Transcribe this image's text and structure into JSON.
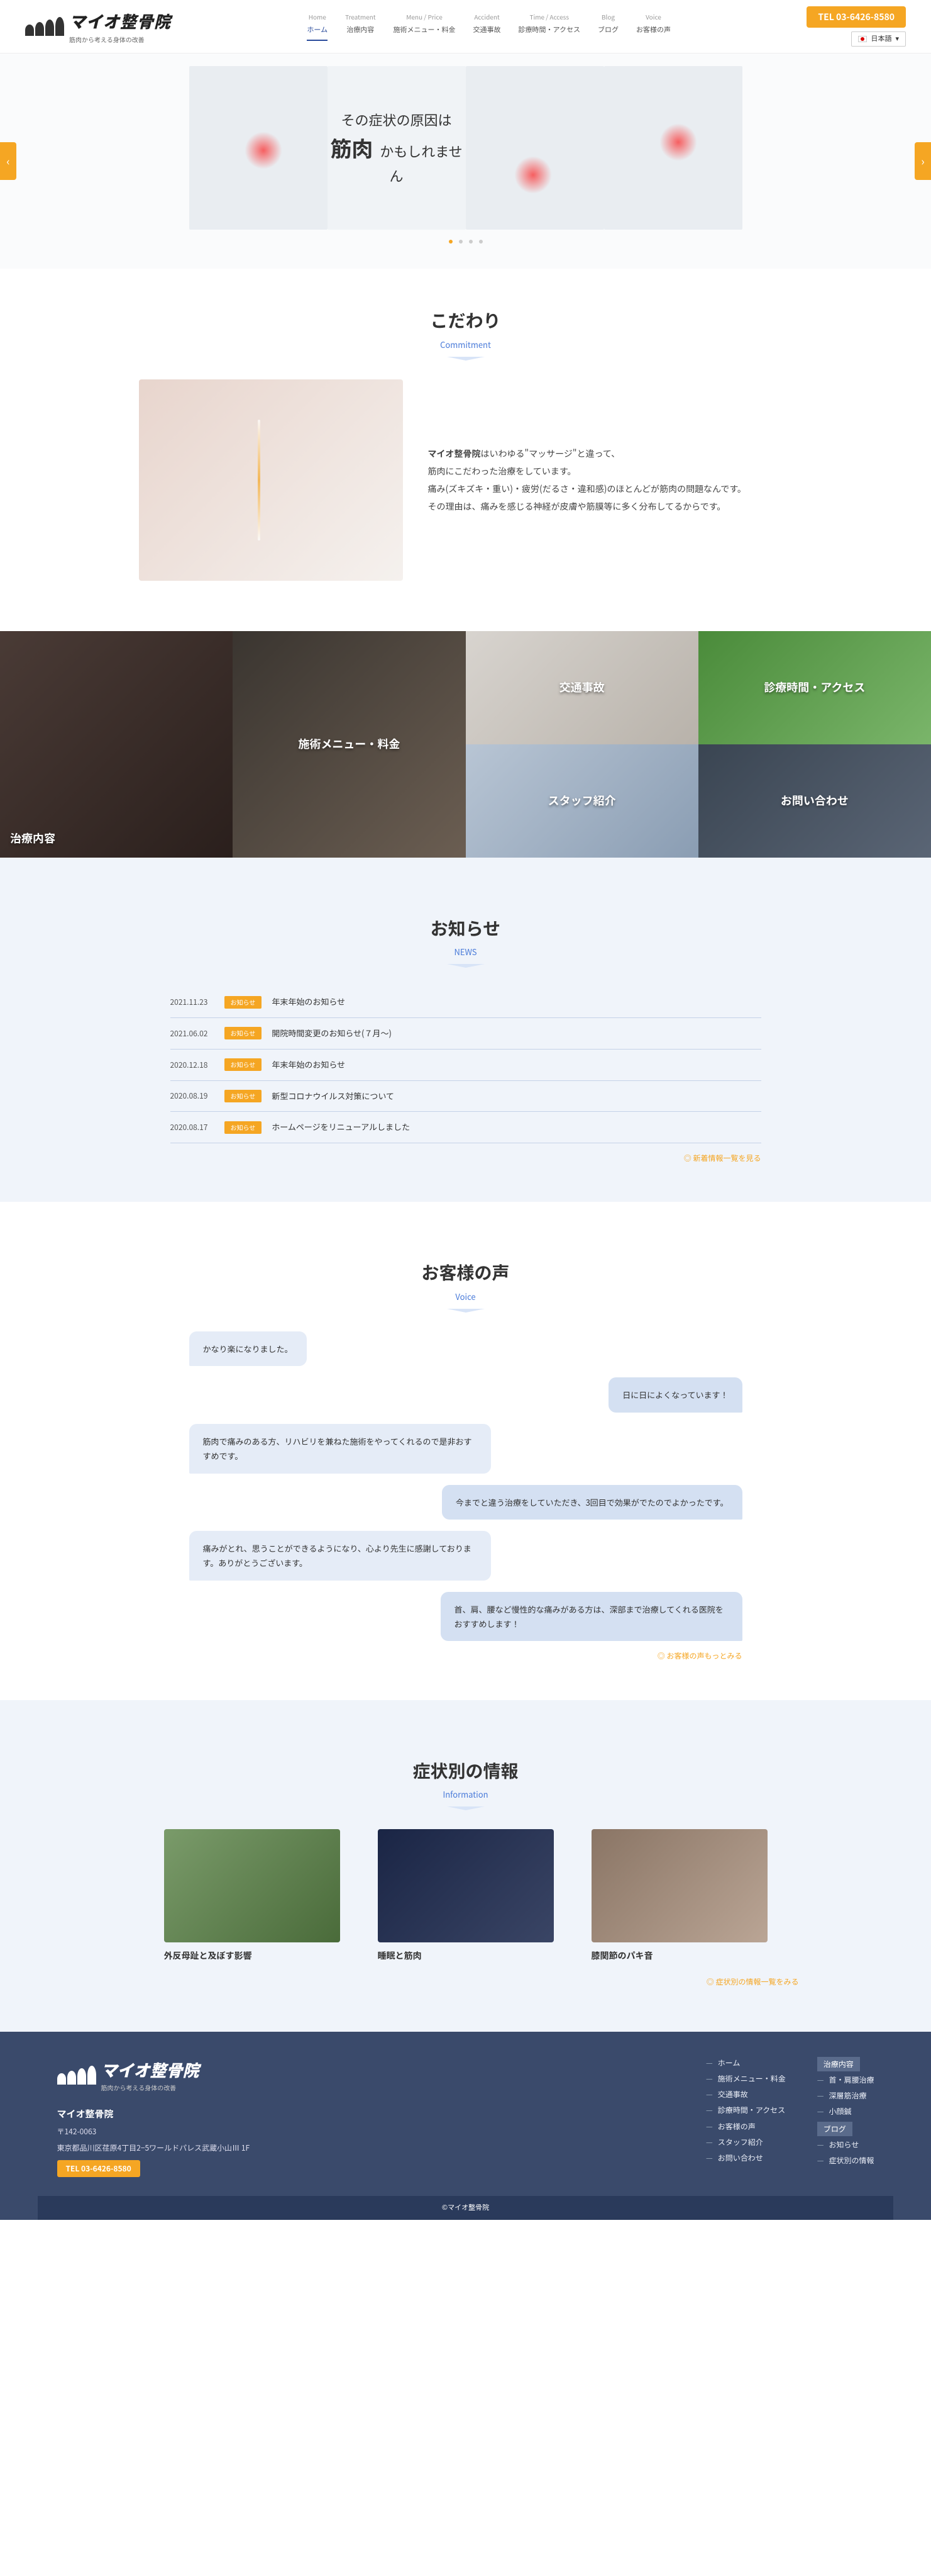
{
  "header": {
    "logo_main": "マイオ整骨院",
    "logo_sub": "筋肉から考える身体の改善",
    "nav": [
      {
        "en": "Home",
        "ja": "ホーム"
      },
      {
        "en": "Treatment",
        "ja": "治療内容"
      },
      {
        "en": "Menu / Price",
        "ja": "施術メニュー・料金"
      },
      {
        "en": "Accident",
        "ja": "交通事故"
      },
      {
        "en": "Time / Access",
        "ja": "診療時間・アクセス"
      },
      {
        "en": "Blog",
        "ja": "ブログ"
      },
      {
        "en": "Voice",
        "ja": "お客様の声"
      }
    ],
    "tel_label": "TEL  03-6426-8580",
    "lang": "日本語"
  },
  "hero": {
    "line1": "その症状の原因は",
    "big": "筋肉",
    "after": " かもしれません"
  },
  "commit": {
    "title": "こだわり",
    "title_en": "Commitment",
    "p1_bold": "マイオ整骨院",
    "p1_rest": "はいわゆる\"マッサージ\"と違って、",
    "p2": "筋肉にこだわった治療をしています。",
    "p3": "痛み(ズキズキ・重い)・疲労(だるさ・違和感)のほとんどが筋肉の問題なんです。",
    "p4": "その理由は、痛みを感じる神経が皮膚や筋膜等に多く分布してるからです。"
  },
  "grid": [
    "治療内容",
    "施術メニュー・料金",
    "交通事故",
    "診療時間・アクセス",
    "スタッフ紹介",
    "お問い合わせ"
  ],
  "news": {
    "title": "お知らせ",
    "title_en": "NEWS",
    "tag": "お知らせ",
    "items": [
      {
        "date": "2021.11.23",
        "title": "年末年始のお知らせ"
      },
      {
        "date": "2021.06.02",
        "title": "開院時間変更のお知らせ(７月〜)"
      },
      {
        "date": "2020.12.18",
        "title": "年末年始のお知らせ"
      },
      {
        "date": "2020.08.19",
        "title": "新型コロナウイルス対策について"
      },
      {
        "date": "2020.08.17",
        "title": "ホームページをリニューアルしました"
      }
    ],
    "more": "新着情報一覧を見る"
  },
  "voice": {
    "title": "お客様の声",
    "title_en": "Voice",
    "items": [
      {
        "side": "left",
        "text": "かなり楽になりました。"
      },
      {
        "side": "right",
        "text": "日に日によくなっています！"
      },
      {
        "side": "left",
        "text": "筋肉で痛みのある方、リハビリを兼ねた施術をやってくれるので是非おすすめです。"
      },
      {
        "side": "right",
        "text": "今までと違う治療をしていただき、3回目で効果がでたのでよかったです。"
      },
      {
        "side": "left",
        "text": "痛みがとれ、思うことができるようになり、心より先生に感謝しております。ありがとうございます。"
      },
      {
        "side": "right",
        "text": "首、肩、腰など慢性的な痛みがある方は、深部まで治療してくれる医院をおすすめします！"
      }
    ],
    "more": "お客様の声もっとみる"
  },
  "info": {
    "title": "症状別の情報",
    "title_en": "Information",
    "cards": [
      {
        "title": "外反母趾と及ぼす影響"
      },
      {
        "title": "睡眠と筋肉"
      },
      {
        "title": "膝関節のパキ音"
      }
    ],
    "more": "症状別の情報一覧をみる"
  },
  "footer": {
    "name": "マイオ整骨院",
    "zip": "〒142-0063",
    "addr": "東京都品川区荏原4丁目2−5ワールドパレス武蔵小山Ⅲ 1F",
    "tel": "TEL  03-6426-8580",
    "col1": [
      "ホーム",
      "施術メニュー・料金",
      "交通事故",
      "診療時間・アクセス",
      "お客様の声",
      "スタッフ紹介",
      "お問い合わせ"
    ],
    "col2_h1": "治療内容",
    "col2_a": [
      "首・肩腰治療",
      "深層筋治療",
      "小顔鍼"
    ],
    "col2_h2": "ブログ",
    "col2_b": [
      "お知らせ",
      "症状別の情報"
    ],
    "copy": "©マイオ整骨院"
  }
}
